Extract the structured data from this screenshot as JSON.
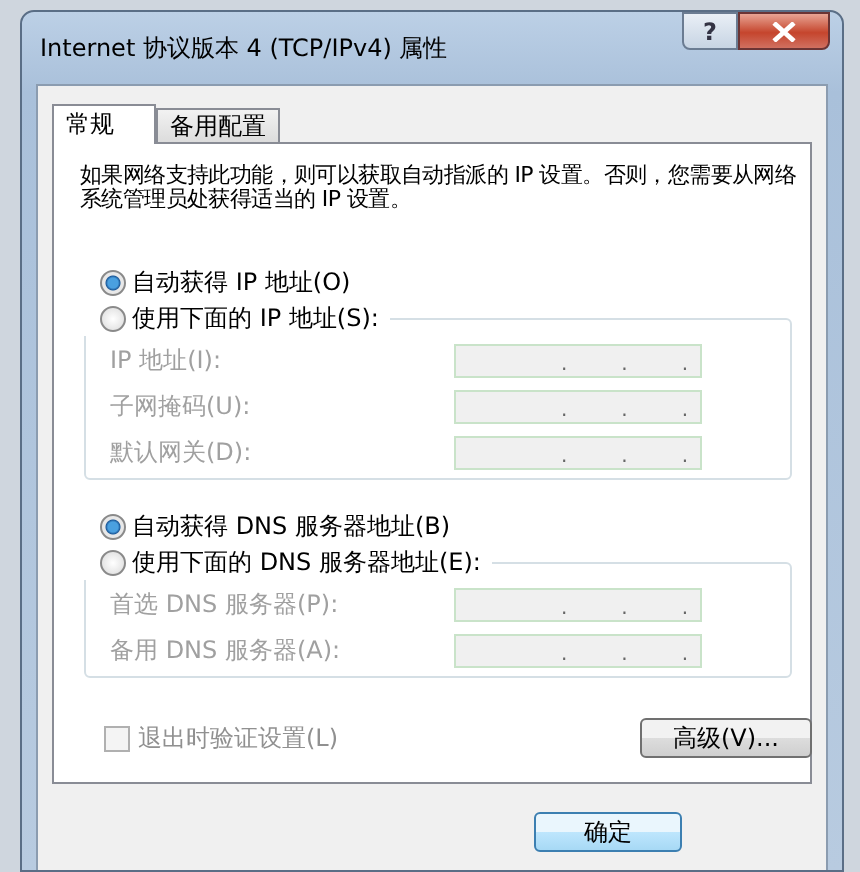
{
  "window": {
    "title": "Internet 协议版本 4 (TCP/IPv4) 属性",
    "help_label": "?"
  },
  "tabs": [
    {
      "label": "常规",
      "selected": true
    },
    {
      "label": "备用配置",
      "selected": false
    }
  ],
  "description": "如果网络支持此功能，则可以获取自动指派的 IP 设置。否则，您需要从网络系统管理员处获得适当的 IP 设置。",
  "ip": {
    "options": [
      {
        "label": "自动获得 IP 地址(O)",
        "selected": true
      },
      {
        "label": "使用下面的 IP 地址(S):",
        "selected": false
      }
    ],
    "fields": [
      {
        "label": "IP 地址(I):",
        "separator": ".",
        "disabled": true
      },
      {
        "label": "子网掩码(U):",
        "separator": ".",
        "disabled": true
      },
      {
        "label": "默认网关(D):",
        "separator": ".",
        "disabled": true
      }
    ]
  },
  "dns": {
    "options": [
      {
        "label": "自动获得 DNS 服务器地址(B)",
        "selected": true
      },
      {
        "label": "使用下面的 DNS 服务器地址(E):",
        "selected": false
      }
    ],
    "fields": [
      {
        "label": "首选 DNS 服务器(P):",
        "separator": ".",
        "disabled": true
      },
      {
        "label": "备用 DNS 服务器(A):",
        "separator": ".",
        "disabled": true
      }
    ]
  },
  "validate": {
    "label": "退出时验证设置(L)",
    "checked": false,
    "disabled": true
  },
  "advanced_button": "高级(V)...",
  "ok_button": "确定"
}
